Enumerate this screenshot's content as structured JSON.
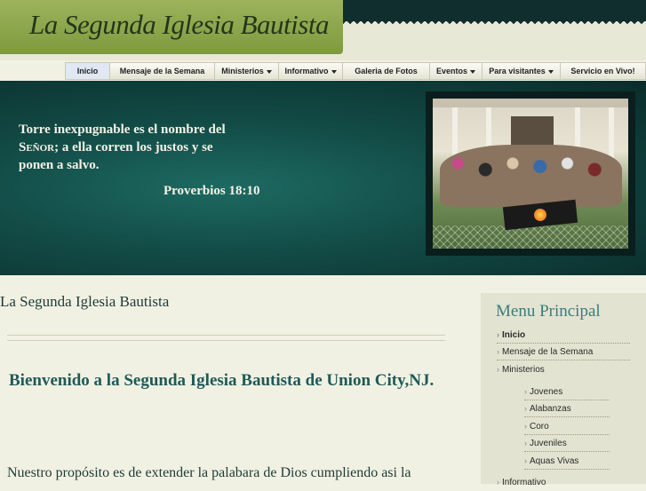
{
  "site": {
    "title": "La Segunda Iglesia Bautista"
  },
  "nav": {
    "items": [
      {
        "label": "Inicio",
        "dropdown": false,
        "active": true
      },
      {
        "label": "Mensaje de la Semana",
        "dropdown": false,
        "active": false
      },
      {
        "label": "Ministerios",
        "dropdown": true,
        "active": false
      },
      {
        "label": "Informativo",
        "dropdown": true,
        "active": false
      },
      {
        "label": "Galeria de Fotos",
        "dropdown": false,
        "active": false
      },
      {
        "label": "Eventos",
        "dropdown": true,
        "active": false
      },
      {
        "label": "Para visitantes",
        "dropdown": true,
        "active": false
      },
      {
        "label": "Servicio en Vivo!",
        "dropdown": false,
        "active": false
      }
    ]
  },
  "banner": {
    "quote_line1": "Torre inexpugnable es el nombre del",
    "quote_line2_smallcaps": "Señor",
    "quote_line2_rest": "; a ella corren los justos y se",
    "quote_line3": "ponen a salvo.",
    "reference": "Proverbios 18:10"
  },
  "main": {
    "page_title": "La Segunda Iglesia Bautista",
    "welcome": "Bienvenido a la Segunda Iglesia Bautista de Union City,NJ.",
    "purpose": "Nuestro propósito es de extender la palabara de Dios cumpliendo asi la"
  },
  "sidebar": {
    "title": "Menu Principal",
    "items": [
      {
        "label": "Inicio",
        "level": 1,
        "active": true
      },
      {
        "label": "Mensaje de la Semana",
        "level": 1,
        "active": false
      },
      {
        "label": "Ministerios",
        "level": 1,
        "active": false
      },
      {
        "label": "Jovenes",
        "level": 2,
        "active": false
      },
      {
        "label": "Alabanzas",
        "level": 2,
        "active": false
      },
      {
        "label": "Coro",
        "level": 2,
        "active": false
      },
      {
        "label": "Juveniles",
        "level": 2,
        "active": false
      },
      {
        "label": "Aquas Vivas",
        "level": 2,
        "active": false
      },
      {
        "label": "Informativo",
        "level": 1,
        "active": false
      }
    ]
  },
  "colors": {
    "accent_green": "#8aa547",
    "banner_teal": "#124a45",
    "heading_teal": "#1f5a58",
    "sidebar_title": "#3a7c7c"
  }
}
